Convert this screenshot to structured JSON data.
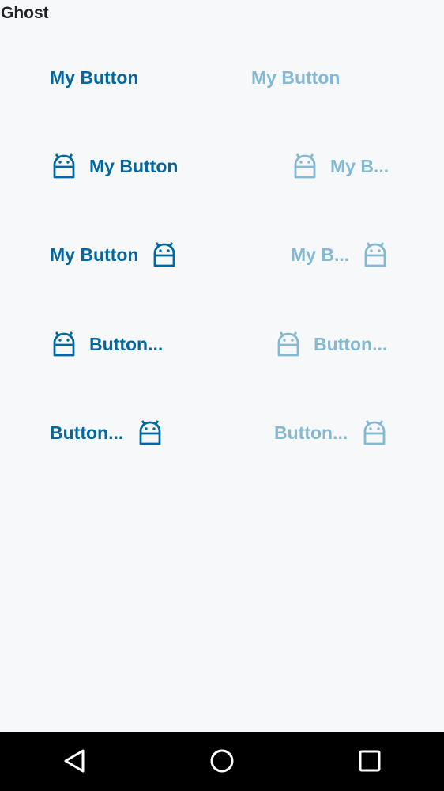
{
  "title": "Ghost",
  "colors": {
    "enabled": "#00689e",
    "disabled": "#85b8d1",
    "background": "#f6f8fa",
    "navbar": "#000000"
  },
  "rows": [
    {
      "enabled_label": "My Button",
      "disabled_label": "My Button"
    },
    {
      "enabled_label": "My Button",
      "disabled_label": "My B..."
    },
    {
      "enabled_label": "My Button",
      "disabled_label": "My B..."
    },
    {
      "enabled_label": "Button...",
      "disabled_label": "Button..."
    },
    {
      "enabled_label": "Button...",
      "disabled_label": "Button..."
    }
  ],
  "icons": {
    "button_icon": "android-icon",
    "nav_back": "back-triangle-icon",
    "nav_home": "home-circle-icon",
    "nav_recents": "recents-square-icon"
  }
}
